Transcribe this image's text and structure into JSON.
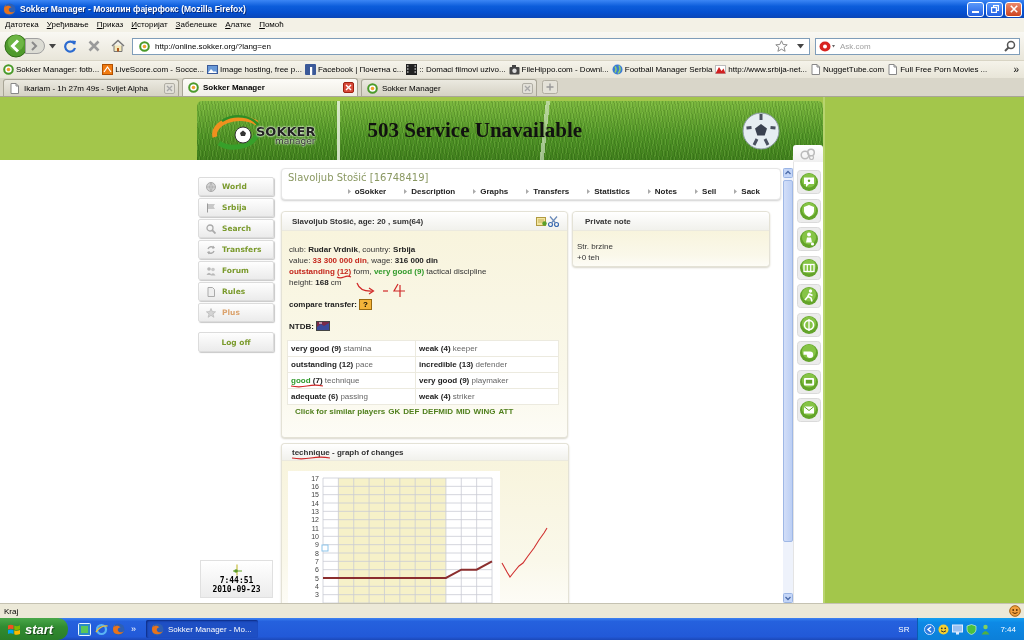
{
  "window": {
    "title": "Sokker Manager - Мозилин фајерфокс (Mozilla Firefox)"
  },
  "menu_bar": [
    "Датотека",
    "Уређивање",
    "Приказ",
    "Историјат",
    "Забелешке",
    "Алатке",
    "Помоћ"
  ],
  "nav_toolbar": {
    "address": "http://online.sokker.org/?lang=en",
    "search_placeholder": "Ask.com"
  },
  "bookmarks": {
    "items": [
      {
        "label": "Sokker Manager: fotb...",
        "kind": "ring"
      },
      {
        "label": "LiveScore.com - Socce...",
        "kind": "square"
      },
      {
        "label": "Image hosting, free p...",
        "kind": "image"
      },
      {
        "label": "Facebook | Почетна с...",
        "kind": "tile"
      },
      {
        "label": ":: Domaci filmovi uzivo...",
        "kind": "film"
      },
      {
        "label": "FileHippo.com - Downl...",
        "kind": "camera"
      },
      {
        "label": "Football Manager Serbia",
        "kind": "globe"
      },
      {
        "label": "http://www.srbija-net...",
        "kind": "flag"
      },
      {
        "label": "NuggetTube.com",
        "kind": "page"
      },
      {
        "label": "Full Free Porn Movies ...",
        "kind": "page"
      }
    ],
    "overflow": "»"
  },
  "tabs": [
    {
      "label": "Ikariam - 1h 27m 49s - Svijet Alpha",
      "kind": "page",
      "selected": false
    },
    {
      "label": "Sokker Manager",
      "kind": "ring",
      "selected": true
    },
    {
      "label": "Sokker Manager",
      "kind": "ring",
      "selected": false
    }
  ],
  "page": {
    "banner": {
      "logo_word": "SOKKER",
      "logo_subword": "manager",
      "title": "503 Service Unavailable"
    },
    "sidebar": {
      "items": [
        {
          "label": "World",
          "kind": "globe",
          "color": "#7a9a2c"
        },
        {
          "label": "Srbija",
          "kind": "flag",
          "color": "#7a9a2c"
        },
        {
          "label": "Search",
          "kind": "magnifier",
          "color": "#7a9a2c"
        },
        {
          "label": "Transfers",
          "kind": "arrows",
          "color": "#7a9a2c"
        },
        {
          "label": "Forum",
          "kind": "people",
          "color": "#7a9a2c"
        },
        {
          "label": "Rules",
          "kind": "page",
          "color": "#7a9a2c"
        },
        {
          "label": "Plus",
          "kind": "star",
          "color": "#dba36e"
        }
      ],
      "logoff": "Log off",
      "clock": {
        "time": "7:44:51",
        "date": "2010-09-23"
      }
    },
    "player": {
      "title": "Slavoljub Stošić [16748419]",
      "nav": [
        "oSokker",
        "Description",
        "Graphs",
        "Transfers",
        "Statistics",
        "Notes",
        "Sell",
        "Sack"
      ]
    },
    "player_card": {
      "heading": "Slavoljub Stošić, age: 20 , sum(64)",
      "info_lines": [
        {
          "segments": [
            {
              "text": "club: ",
              "kind": "plain"
            },
            {
              "text": "Rudar Vrdnik",
              "kind": "bold"
            },
            {
              "text": ", country: ",
              "kind": "plain"
            },
            {
              "text": "Srbija",
              "kind": "bold"
            }
          ],
          "pen_arrow": false
        },
        {
          "segments": [
            {
              "text": "value: ",
              "kind": "plain"
            },
            {
              "text": "33 300 000 din",
              "kind": "alert"
            },
            {
              "text": ", wage: ",
              "kind": "plain"
            },
            {
              "text": "316 000 din",
              "kind": "bold"
            }
          ],
          "pen_arrow": false
        },
        {
          "segments": [
            {
              "text": "outstanding ",
              "kind": "alert"
            },
            {
              "text": "(12)",
              "kind": "alert",
              "pen_underline": true
            },
            {
              "text": " form, ",
              "kind": "plain"
            },
            {
              "text": "very good (9)",
              "kind": "good"
            },
            {
              "text": " tactical discipline",
              "kind": "plain"
            }
          ],
          "pen_arrow": false
        },
        {
          "segments": [
            {
              "text": "height: ",
              "kind": "plain"
            },
            {
              "text": "168",
              "kind": "bold"
            },
            {
              "text": " cm",
              "kind": "plain"
            }
          ],
          "pen_arrow": true
        }
      ],
      "compare_label": "compare transfer:",
      "compare_button": "?",
      "ntdb_label": "NTDB:",
      "skills": [
        [
          {
            "rating": "very good",
            "value": "(9)",
            "skill": "stamina",
            "highlight": false,
            "pen_underline": false
          },
          {
            "rating": "weak",
            "value": "(4)",
            "skill": "keeper",
            "highlight": false,
            "pen_underline": false
          }
        ],
        [
          {
            "rating": "outstanding",
            "value": "(12)",
            "skill": "pace",
            "highlight": false,
            "pen_underline": false
          },
          {
            "rating": "incredible",
            "value": "(13)",
            "skill": "defender",
            "highlight": false,
            "pen_underline": false
          }
        ],
        [
          {
            "rating": "good",
            "value": "(7)",
            "skill": "technique",
            "highlight": true,
            "pen_underline": true
          },
          {
            "rating": "very good",
            "value": "(9)",
            "skill": "playmaker",
            "highlight": false,
            "pen_underline": false
          }
        ],
        [
          {
            "rating": "adequate",
            "value": "(6)",
            "skill": "passing",
            "highlight": false,
            "pen_underline": false
          },
          {
            "rating": "weak",
            "value": "(4)",
            "skill": "striker",
            "highlight": false,
            "pen_underline": false
          }
        ]
      ],
      "similar_label": "Click for similar players",
      "similar_links": [
        "GK",
        "DEF",
        "DEFMID",
        "MID",
        "WING",
        "ATT"
      ]
    },
    "private_note": {
      "heading": "Private note",
      "lines": [
        "Str. brzine",
        "+0 teh"
      ]
    },
    "graph": {
      "heading": [
        {
          "text": "technique",
          "pen_underline": true
        },
        {
          "text": " - graph of changes",
          "pen_underline": false
        }
      ],
      "chart_data": {
        "type": "line",
        "values": [
          5,
          5,
          5,
          5,
          5,
          5,
          5,
          5,
          5,
          6,
          6,
          7
        ],
        "ylim": [
          2,
          17
        ],
        "yticks": [
          3,
          4,
          5,
          6,
          7,
          8,
          9,
          10,
          11,
          12,
          13,
          14,
          15,
          16,
          17
        ],
        "grid": true
      },
      "pen_sketch": true
    },
    "quick_icons": [
      {
        "kind": "help"
      },
      {
        "kind": "shield"
      },
      {
        "kind": "player"
      },
      {
        "kind": "stadium"
      },
      {
        "kind": "runner"
      },
      {
        "kind": "money"
      },
      {
        "kind": "whistle"
      },
      {
        "kind": "tv"
      },
      {
        "kind": "mail"
      }
    ]
  },
  "status_bar": {
    "text": "Kraj"
  },
  "taskbar": {
    "start": "start",
    "overflow": "»",
    "tasks": [
      {
        "label": "Sokker Manager - Mo...",
        "selected": true
      }
    ],
    "language": "SR",
    "clock": "7:44"
  }
}
